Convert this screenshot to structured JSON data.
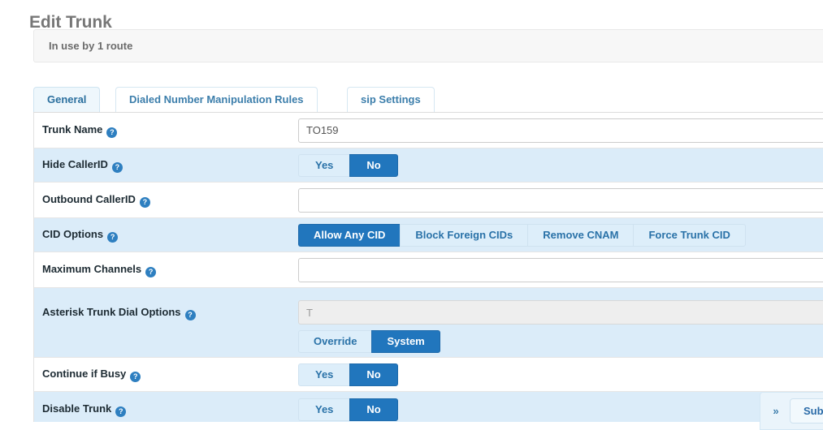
{
  "page": {
    "title": "Edit Trunk"
  },
  "alert": {
    "text": "In use by 1 route"
  },
  "tabs": [
    {
      "label": "General",
      "active": true
    },
    {
      "label": "Dialed Number Manipulation Rules",
      "active": false
    },
    {
      "label": "sip Settings",
      "active": false
    }
  ],
  "help_icon": "?",
  "form": {
    "trunk_name": {
      "label": "Trunk Name",
      "value": "TO159",
      "placeholder": ""
    },
    "hide_callerid": {
      "label": "Hide CallerID",
      "options": [
        "Yes",
        "No"
      ],
      "selected": "No"
    },
    "outbound_callerid": {
      "label": "Outbound CallerID",
      "value": "",
      "placeholder": ""
    },
    "cid_options": {
      "label": "CID Options",
      "options": [
        "Allow Any CID",
        "Block Foreign CIDs",
        "Remove CNAM",
        "Force Trunk CID"
      ],
      "selected": "Allow Any CID"
    },
    "maximum_channels": {
      "label": "Maximum Channels",
      "value": "",
      "placeholder": ""
    },
    "asterisk_trunk_dial_options": {
      "label": "Asterisk Trunk Dial Options",
      "value": "T",
      "disabled": true,
      "options": [
        "Override",
        "System"
      ],
      "selected": "System"
    },
    "continue_if_busy": {
      "label": "Continue if Busy",
      "options": [
        "Yes",
        "No"
      ],
      "selected": "No"
    },
    "disable_trunk": {
      "label": "Disable Trunk",
      "options": [
        "Yes",
        "No"
      ],
      "selected": "No"
    }
  },
  "footer": {
    "expand_label": "»",
    "submit_label": "Submit"
  },
  "colors": {
    "accent_active": "#2176bd",
    "row_alt": "#dbecf9",
    "link": "#2a72a8",
    "title": "#777777"
  }
}
